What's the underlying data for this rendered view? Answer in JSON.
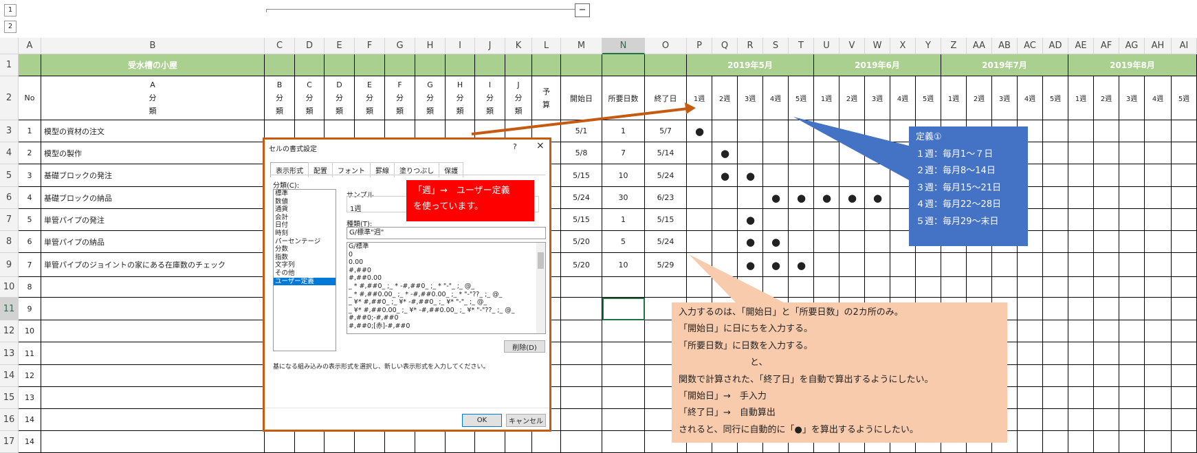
{
  "outline_levels": [
    "1",
    "2"
  ],
  "outline_collapse": "−",
  "columns": [
    "A",
    "B",
    "C",
    "D",
    "E",
    "F",
    "G",
    "H",
    "I",
    "J",
    "K",
    "L",
    "M",
    "N",
    "O",
    "P",
    "Q",
    "R",
    "S",
    "T",
    "U",
    "V",
    "W",
    "X",
    "Y",
    "Z",
    "AA",
    "AB",
    "AC",
    "AD",
    "AE",
    "AF",
    "AG",
    "AH",
    "AI"
  ],
  "row_numbers": [
    "1",
    "2",
    "3",
    "4",
    "5",
    "6",
    "7",
    "8",
    "9",
    "10",
    "11",
    "12",
    "13",
    "14",
    "15",
    "16",
    "17"
  ],
  "title_row": {
    "hut": "受水槽の小屋",
    "months": [
      "2019年5月",
      "2019年6月",
      "2019年7月",
      "2019年8月"
    ]
  },
  "header_row": {
    "no": "No",
    "bunrui_a": [
      "A",
      "分",
      "類"
    ],
    "bunrui_cols": [
      [
        "B",
        "分",
        "類"
      ],
      [
        "C",
        "分",
        "類"
      ],
      [
        "D",
        "分",
        "類"
      ],
      [
        "E",
        "分",
        "類"
      ],
      [
        "F",
        "分",
        "類"
      ],
      [
        "G",
        "分",
        "類"
      ],
      [
        "H",
        "分",
        "類"
      ],
      [
        "I",
        "分",
        "類"
      ],
      [
        "J",
        "分",
        "類"
      ]
    ],
    "yosan": [
      "予",
      "算"
    ],
    "start": "開始日",
    "days": "所要日数",
    "end": "終了日",
    "weeks": [
      "1週",
      "2週",
      "3週",
      "4週",
      "5週"
    ]
  },
  "rows": [
    {
      "no": "1",
      "name": "模型の資材の注文",
      "start": "5/1",
      "days": "1",
      "end": "5/7"
    },
    {
      "no": "2",
      "name": "模型の製作",
      "start": "5/8",
      "days": "7",
      "end": "5/14"
    },
    {
      "no": "3",
      "name": "基礎ブロックの発注",
      "start": "5/15",
      "days": "10",
      "end": "5/24"
    },
    {
      "no": "4",
      "name": "基礎ブロックの納品",
      "start": "5/24",
      "days": "30",
      "end": "6/23"
    },
    {
      "no": "5",
      "name": "単管パイプの発注",
      "start": "5/15",
      "days": "1",
      "end": "5/15"
    },
    {
      "no": "6",
      "name": "単管パイプの納品",
      "start": "5/20",
      "days": "5",
      "end": "5/24"
    },
    {
      "no": "7",
      "name": "単管パイプのジョイントの家にある在庫数のチェック",
      "start": "5/20",
      "days": "10",
      "end": "5/29"
    },
    {
      "no": "8",
      "name": "",
      "start": "",
      "days": "",
      "end": ""
    },
    {
      "no": "9",
      "name": "",
      "start": "",
      "days": "",
      "end": ""
    },
    {
      "no": "10",
      "name": "",
      "start": "",
      "days": "",
      "end": ""
    },
    {
      "no": "11",
      "name": "",
      "start": "",
      "days": "",
      "end": ""
    },
    {
      "no": "12",
      "name": "",
      "start": "",
      "days": "",
      "end": ""
    },
    {
      "no": "13",
      "name": "",
      "start": "",
      "days": "",
      "end": ""
    },
    {
      "no": "14",
      "name": "",
      "start": "",
      "days": "",
      "end": ""
    },
    {
      "no": "14",
      "name": "",
      "start": "",
      "days": "",
      "end": ""
    }
  ],
  "dot_glyph": "●",
  "dots": [
    [
      0,
      0
    ],
    [
      1,
      1
    ],
    [
      2,
      1
    ],
    [
      2,
      2
    ],
    [
      3,
      3
    ],
    [
      3,
      4
    ],
    [
      3,
      5
    ],
    [
      3,
      6
    ],
    [
      3,
      7
    ],
    [
      4,
      2
    ],
    [
      5,
      2
    ],
    [
      5,
      3
    ],
    [
      6,
      2
    ],
    [
      6,
      3
    ],
    [
      6,
      4
    ]
  ],
  "dialog": {
    "title": "セルの書式設定",
    "help": "?",
    "close": "×",
    "tabs": [
      "表示形式",
      "配置",
      "フォント",
      "罫線",
      "塗りつぶし",
      "保護"
    ],
    "category_label": "分類(C):",
    "categories": [
      "標準",
      "数値",
      "通貨",
      "会計",
      "日付",
      "時刻",
      "パーセンテージ",
      "分数",
      "指数",
      "文字列",
      "その他",
      "ユーザー定義"
    ],
    "selected_category": "ユーザー定義",
    "sample_label": "サンプル",
    "sample_value": "1週",
    "type_label": "種類(T):",
    "type_value": "G/標準\"週\"",
    "formats": [
      "G/標準",
      "0",
      "0.00",
      "#,##0",
      "#,##0.00",
      "_ * #,##0_ ;_ * -#,##0_ ;_ * \"-\"_ ;_ @_",
      "_ * #,##0.00_ ;_ * -#,##0.00_ ;_ * \"-\"??_ ;_ @_",
      "_ ¥* #,##0_ ;_ ¥* -#,##0_ ;_ ¥* \"-\"_ ;_ @_",
      "_ ¥* #,##0.00_ ;_ ¥* -#,##0.00_ ;_ ¥* \"-\"??_ ;_ @_",
      "#,##0;-#,##0",
      "#,##0;[赤]-#,##0"
    ],
    "delete": "削除(D)",
    "hint": "基になる組み込みの表示形式を選択し、新しい表示形式を入力してください。",
    "ok": "OK",
    "cancel": "キャンセル"
  },
  "callout_red": [
    "「週」→　ユーザー定義",
    "を使っています。"
  ],
  "callout_blue": [
    "定義①",
    "１週：毎月1～７日",
    "２週：毎月8～14日",
    "３週：毎月15～21日",
    "４週：毎月22～28日",
    "５週：毎月29～末日"
  ],
  "callout_peach": [
    "入力するのは、「開始日」と「所要日数」の2カ所のみ。",
    "「開始日」に日にちを入力する。",
    "「所要日数」に日数を入力する。",
    "　　　　　　　　と、",
    "関数で計算された、「終了日」を自動で算出するようにしたい。",
    "「開始日」→　手入力",
    "「終了日」→　自動算出",
    "されると、同行に自動的に「●」を算出するようにしたい。"
  ],
  "colors": {
    "title_fill": "#a9d08e",
    "dialog_border": "#c55a11",
    "arrow": "#c55a11",
    "red": "#ff0000",
    "blue": "#4472c4",
    "peach": "#f8cbad",
    "selected_cell": "#217346"
  }
}
